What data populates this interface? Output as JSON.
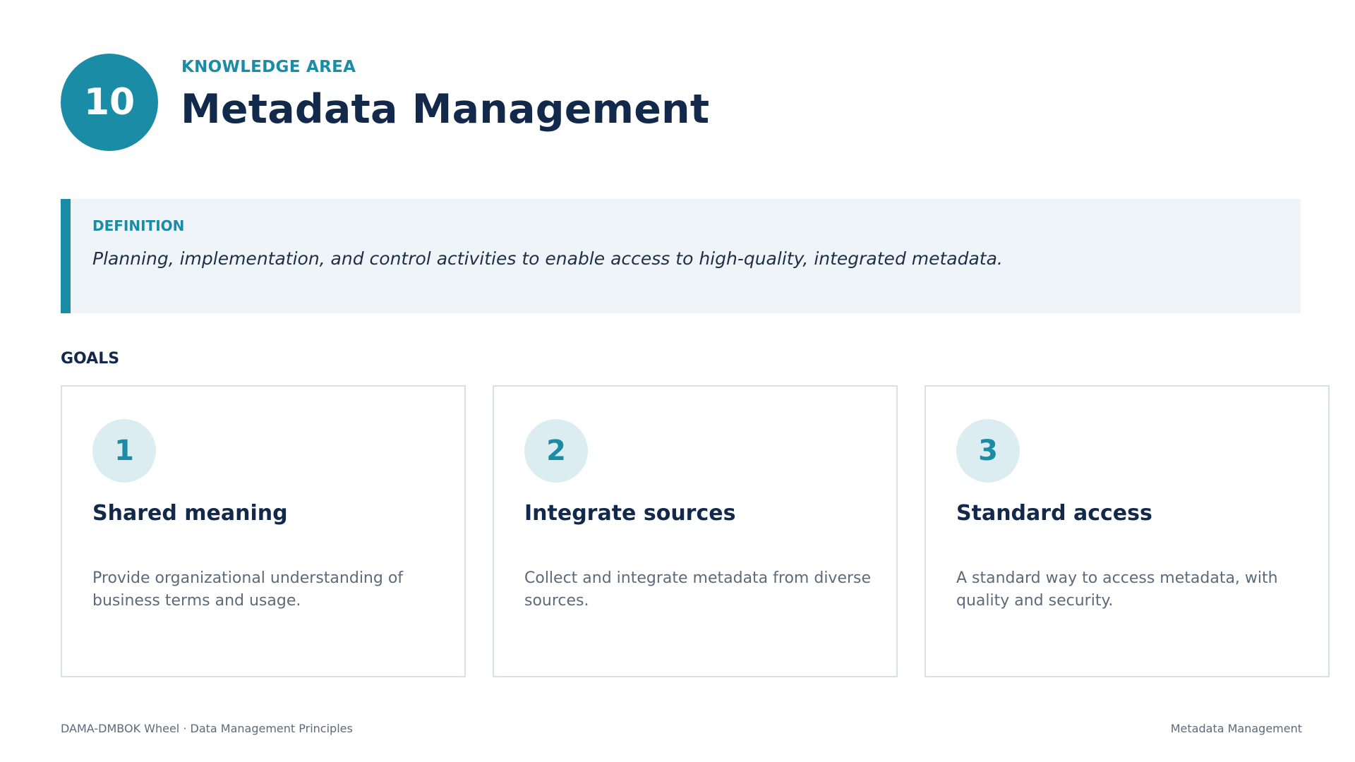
{
  "header": {
    "number": "10",
    "kicker": "KNOWLEDGE AREA",
    "title": "Metadata Management"
  },
  "definition": {
    "label": "DEFINITION",
    "text": "Planning, implementation, and control activities to enable access to high-quality, integrated metadata."
  },
  "goals": {
    "label": "GOALS",
    "items": [
      {
        "number": "1",
        "title": "Shared meaning",
        "description": "Provide organizational understanding of business terms and usage."
      },
      {
        "number": "2",
        "title": "Integrate sources",
        "description": "Collect and integrate metadata from diverse sources."
      },
      {
        "number": "3",
        "title": "Standard access",
        "description": "A standard way to access metadata, with quality and security."
      }
    ]
  },
  "footer": {
    "left": "DAMA-DMBOK Wheel  ·  Data Management Principles",
    "right": "Metadata Management"
  },
  "colors": {
    "accent": "#1b8ca6",
    "heading": "#13294b",
    "definition_bg": "#eef4f8",
    "number_bg": "#dcedf2"
  }
}
